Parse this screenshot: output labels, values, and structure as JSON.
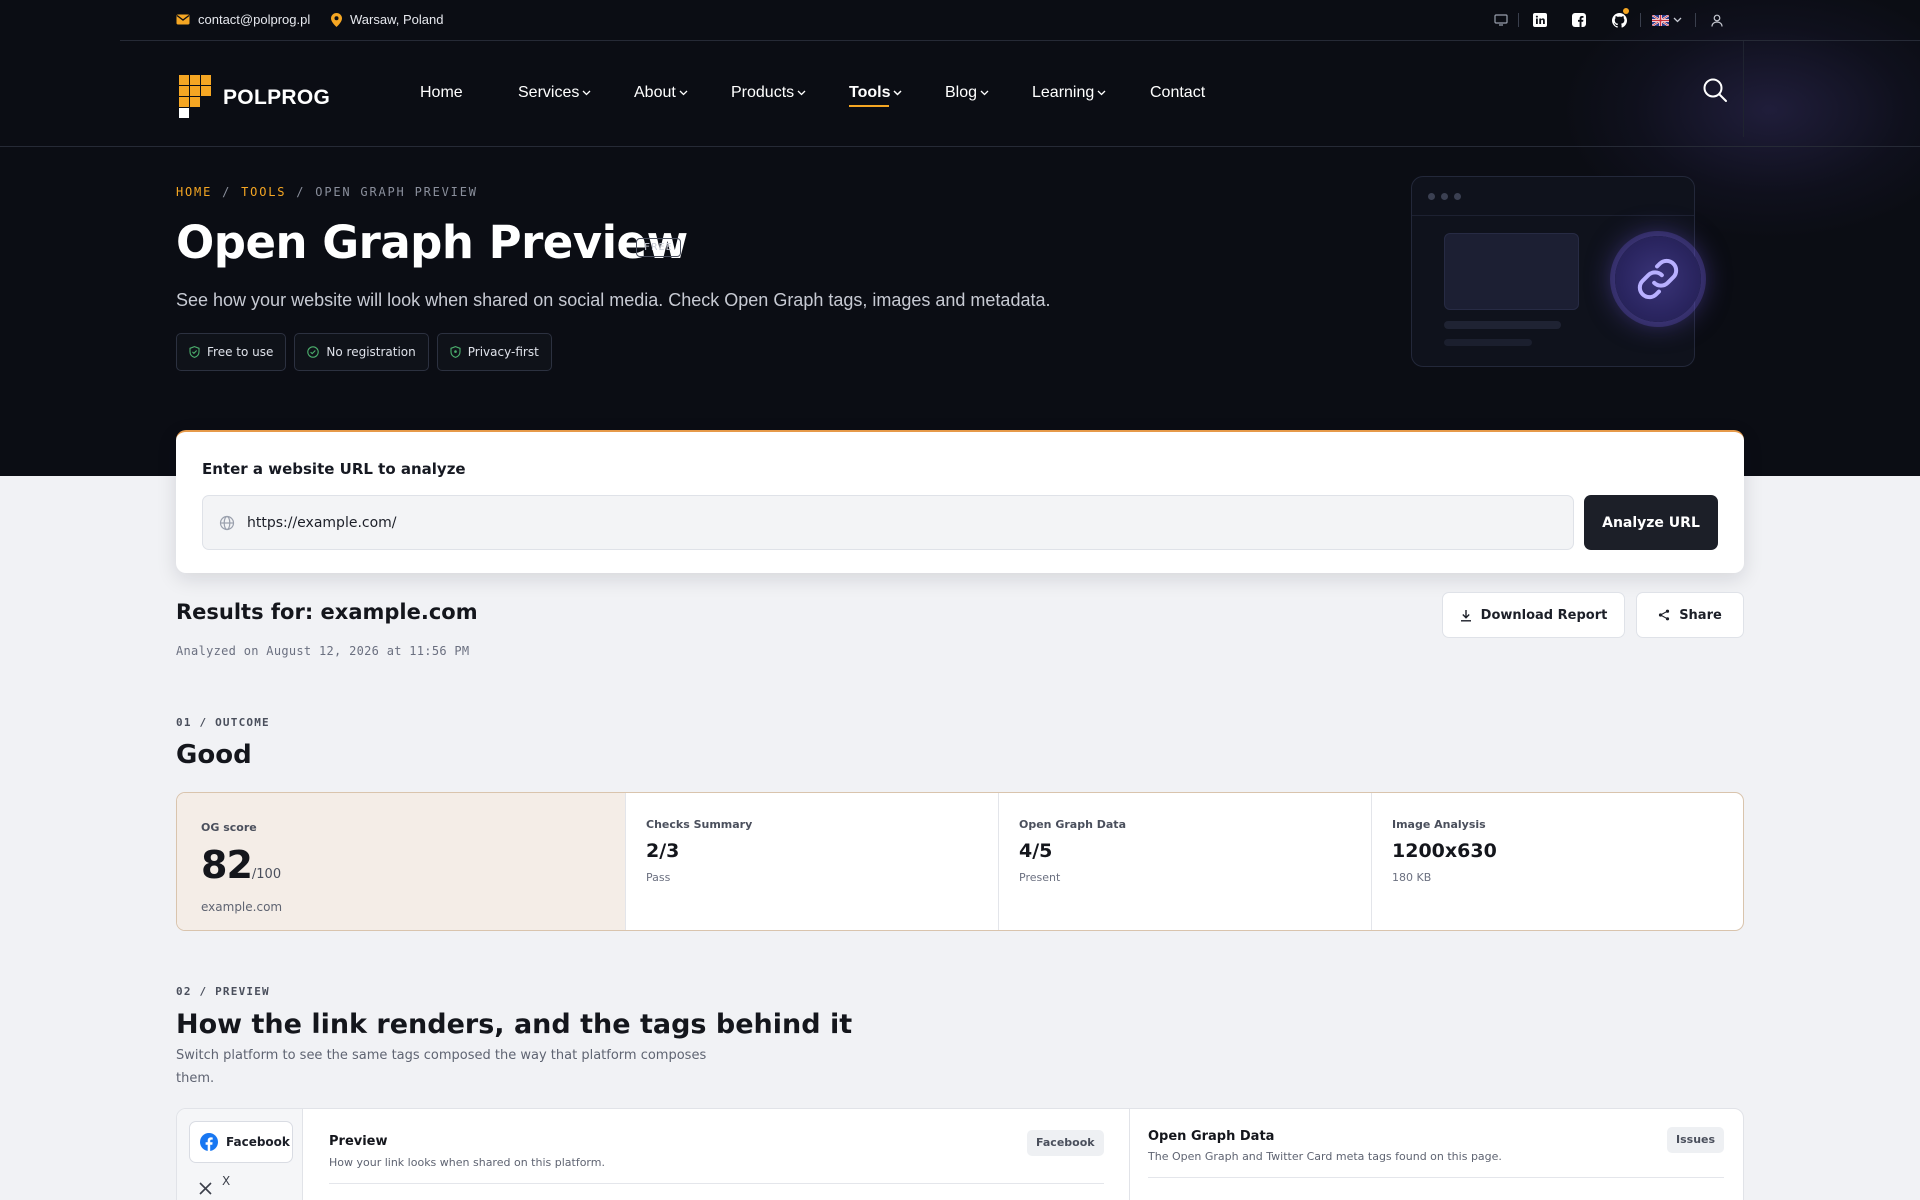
{
  "topbar": {
    "email": "contact@polprog.pl",
    "location": "Warsaw, Poland",
    "icons": [
      "monitor-icon",
      "linkedin-icon",
      "facebook-icon",
      "github-icon",
      "uk-flag-icon",
      "user-icon"
    ]
  },
  "nav": {
    "logo_text": "POLPROG",
    "menu": [
      {
        "label": "Home"
      },
      {
        "label": "Services"
      },
      {
        "label": "About"
      },
      {
        "label": "Products"
      },
      {
        "label": "Tools"
      },
      {
        "label": "Blog"
      },
      {
        "label": "Learning"
      },
      {
        "label": "Contact"
      }
    ],
    "active": "Tools"
  },
  "hero": {
    "breadcrumb": [
      "HOME",
      "TOOLS",
      "OPEN GRAPH PREVIEW"
    ],
    "title": "Open Graph Preview",
    "badge": "FREE",
    "subtitle": "See how your website will look when shared on social media. Check Open Graph tags, images and metadata.",
    "pills": [
      "Free to use",
      "No registration",
      "Privacy-first"
    ]
  },
  "analyze": {
    "label": "Enter a website URL to analyze",
    "url_value": "https://example.com/",
    "button": "Analyze URL"
  },
  "results": {
    "title": "Results for: example.com",
    "date": "Analyzed on August 12, 2026 at 11:56 PM",
    "download_label": "Download Report",
    "share_label": "Share"
  },
  "outcome": {
    "kicker": "01  /  OUTCOME",
    "title": "Good",
    "score_label": "OG score",
    "score": "82",
    "score_unit": "/100",
    "score_domain": "example.com",
    "cards": [
      {
        "label": "Checks Summary",
        "value": "2/3",
        "note": "Pass"
      },
      {
        "label": "Open Graph Data",
        "value": "4/5",
        "note": "Present"
      },
      {
        "label": "Image Analysis",
        "value": "1200x630",
        "note": "180 KB"
      }
    ]
  },
  "preview": {
    "kicker": "02  /  PREVIEW",
    "title": "How the link renders, and the tags behind it",
    "description": "Switch platform to see the same tags composed the way that platform composes them.",
    "platforms": [
      "Facebook",
      "X"
    ],
    "panel_title": "Preview",
    "panel_sub": "How your link looks when shared on this platform.",
    "panel_chip": "Facebook",
    "og_title": "Open Graph Data",
    "og_sub": "The Open Graph and Twitter Card meta tags found on this page.",
    "og_chip": "Issues"
  },
  "colors": {
    "accent": "#f5a623",
    "dark_bg": "#0b0d14",
    "page_bg": "#f1f2f5"
  }
}
